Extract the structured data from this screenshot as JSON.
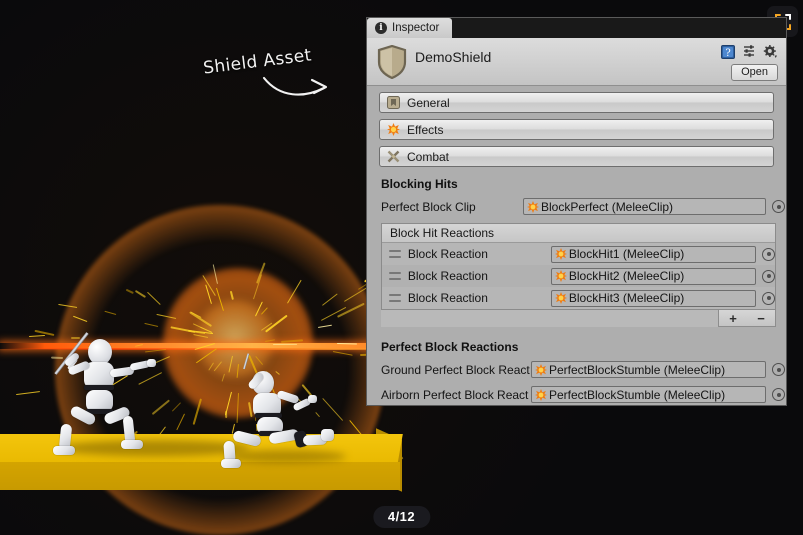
{
  "scene": {
    "annotation": "Shield Asset",
    "annotation_arrow": "curved-arrow-right",
    "page_indicator": "4/12",
    "fullscreen_icon": "fullscreen-expand-icon",
    "accent_orange": "#ff6a10",
    "spark_yellow": "#ffd426",
    "platform_yellow": "#f3c50c"
  },
  "inspector": {
    "tab": {
      "label": "Inspector",
      "icon": "info-circle-icon"
    },
    "object": {
      "name": "DemoShield",
      "icon": "shield-icon",
      "header_icons": [
        "help-book-icon",
        "preset-sliders-icon",
        "gear-icon"
      ],
      "open_button": "Open"
    },
    "sections": [
      {
        "label": "General",
        "icon": "general-tag-icon"
      },
      {
        "label": "Effects",
        "icon": "effects-burst-icon"
      },
      {
        "label": "Combat",
        "icon": "combat-swords-icon"
      }
    ],
    "blocking_hits": {
      "title": "Blocking Hits",
      "perfect_block_clip": {
        "label": "Perfect Block Clip",
        "value": "BlockPerfect (MeleeClip)",
        "icon": "melee-clip-burst-icon",
        "picker": "object-picker-icon"
      },
      "reactions_list": {
        "header": "Block Hit Reactions",
        "rows": [
          {
            "label": "Block Reaction",
            "value": "BlockHit1 (MeleeClip)",
            "icon": "melee-clip-burst-icon",
            "handle": "drag-handle-icon",
            "picker": "object-picker-icon"
          },
          {
            "label": "Block Reaction",
            "value": "BlockHit2 (MeleeClip)",
            "icon": "melee-clip-burst-icon",
            "handle": "drag-handle-icon",
            "picker": "object-picker-icon"
          },
          {
            "label": "Block Reaction",
            "value": "BlockHit3 (MeleeClip)",
            "icon": "melee-clip-burst-icon",
            "handle": "drag-handle-icon",
            "picker": "object-picker-icon"
          }
        ],
        "add_button": "+",
        "remove_button": "−"
      }
    },
    "perfect_block_reactions": {
      "title": "Perfect Block Reactions",
      "rows": [
        {
          "label": "Ground Perfect Block React",
          "value": "PerfectBlockStumble (MeleeClip)",
          "icon": "melee-clip-burst-icon",
          "picker": "object-picker-icon"
        },
        {
          "label": "Airborn Perfect Block React",
          "value": "PerfectBlockStumble (MeleeClip)",
          "icon": "melee-clip-burst-icon",
          "picker": "object-picker-icon"
        }
      ]
    }
  }
}
